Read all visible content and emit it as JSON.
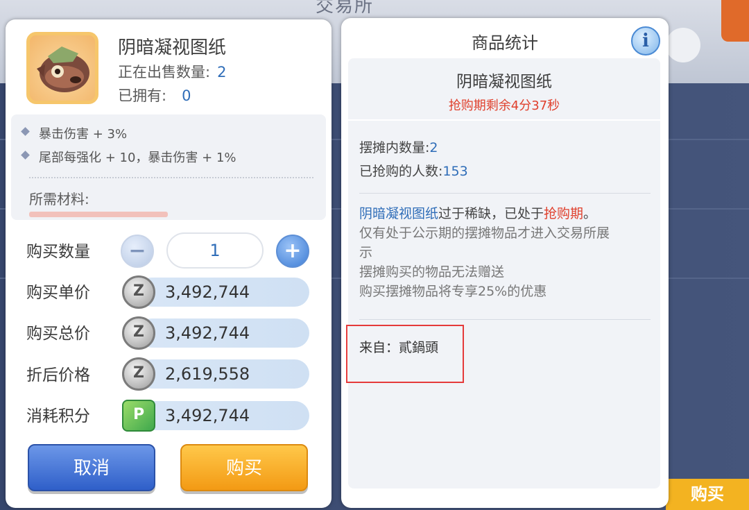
{
  "background": {
    "title": "交易所",
    "corner_button": "购买"
  },
  "purchase_panel": {
    "item_name": "阴暗凝视图纸",
    "on_sale_label": "正在出售数量:",
    "on_sale_count": "2",
    "owned_label": "已拥有:",
    "owned_count": "0",
    "stats": [
      "暴击伤害 + 3%",
      "尾部每强化 + 10，暴击伤害 + 1%"
    ],
    "materials_label": "所需材料:",
    "quantity_label": "购买数量",
    "quantity_value": "1",
    "unit_price_label": "购买单价",
    "unit_price": "3,492,744",
    "total_price_label": "购买总价",
    "total_price": "3,492,744",
    "discount_price_label": "折后价格",
    "discount_price": "2,619,558",
    "points_label": "消耗积分",
    "points_value": "3,492,744",
    "cancel_label": "取消",
    "buy_label": "购买"
  },
  "stats_panel": {
    "title": "商品统计",
    "item_name": "阴暗凝视图纸",
    "timer_text": "抢购期剩余4分37秒",
    "stall_qty_label": "摆摊内数量:",
    "stall_qty": "2",
    "buyers_label": "已抢购的人数:",
    "buyers": "153",
    "notice_item": "阴暗凝视图纸",
    "notice_mid": "过于稀缺，已处于",
    "notice_phase": "抢购期",
    "notice_end": "。",
    "notice_lines": [
      "仅有处于公示期的摆摊物品才进入交易所展",
      "示",
      "摆摊购买的物品无法赠送",
      "购买摆摊物品将专享25%的优惠"
    ],
    "from_text": "来自：貳鍋頭"
  },
  "icons": {
    "zeny": "zeny-coin-icon",
    "points": "point-card-icon",
    "info": "info-icon",
    "minus": "minus-icon",
    "plus": "plus-icon"
  },
  "colors": {
    "accent_blue": "#2f6db8",
    "alert_red": "#e0402d",
    "cancel_blue": "#2f5fc9",
    "buy_orange": "#f39a14"
  }
}
